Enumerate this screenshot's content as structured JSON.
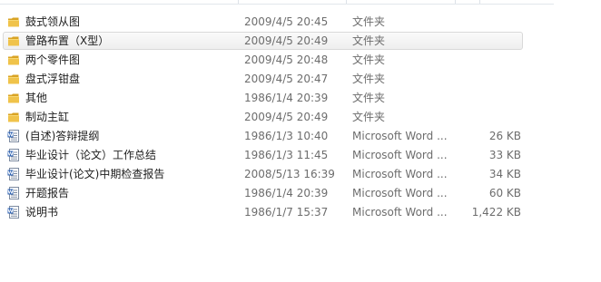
{
  "colors": {
    "folder": "#e8b83a",
    "doc_blue": "#2a5fb0",
    "selection_border": "#d9d9d9"
  },
  "files": [
    {
      "name": "鼓式领从图",
      "date": "2009/4/5 20:45",
      "type": "文件夹",
      "size": "",
      "icon": "folder-icon",
      "selected": false
    },
    {
      "name": "管路布置（X型）",
      "date": "2009/4/5 20:49",
      "type": "文件夹",
      "size": "",
      "icon": "folder-icon",
      "selected": true
    },
    {
      "name": "两个零件图",
      "date": "2009/4/5 20:48",
      "type": "文件夹",
      "size": "",
      "icon": "folder-icon",
      "selected": false
    },
    {
      "name": "盘式浮钳盘",
      "date": "2009/4/5 20:47",
      "type": "文件夹",
      "size": "",
      "icon": "folder-icon",
      "selected": false
    },
    {
      "name": "其他",
      "date": "1986/1/4 20:39",
      "type": "文件夹",
      "size": "",
      "icon": "folder-icon",
      "selected": false
    },
    {
      "name": "制动主缸",
      "date": "2009/4/5 20:49",
      "type": "文件夹",
      "size": "",
      "icon": "folder-icon",
      "selected": false
    },
    {
      "name": "(自述)答辩提纲",
      "date": "1986/1/3 10:40",
      "type": "Microsoft Word ...",
      "size": "26 KB",
      "icon": "word-document-icon",
      "selected": false
    },
    {
      "name": "毕业设计（论文）工作总结",
      "date": "1986/1/3 11:45",
      "type": "Microsoft Word ...",
      "size": "33 KB",
      "icon": "word-document-icon",
      "selected": false
    },
    {
      "name": "毕业设计(论文)中期检查报告",
      "date": "2008/5/13 16:39",
      "type": "Microsoft Word ...",
      "size": "34 KB",
      "icon": "word-document-icon",
      "selected": false
    },
    {
      "name": "开题报告",
      "date": "1986/1/4 20:39",
      "type": "Microsoft Word ...",
      "size": "60 KB",
      "icon": "word-document-icon",
      "selected": false
    },
    {
      "name": "说明书",
      "date": "1986/1/7 15:37",
      "type": "Microsoft Word ...",
      "size": "1,422 KB",
      "icon": "word-document-icon",
      "selected": false
    }
  ]
}
